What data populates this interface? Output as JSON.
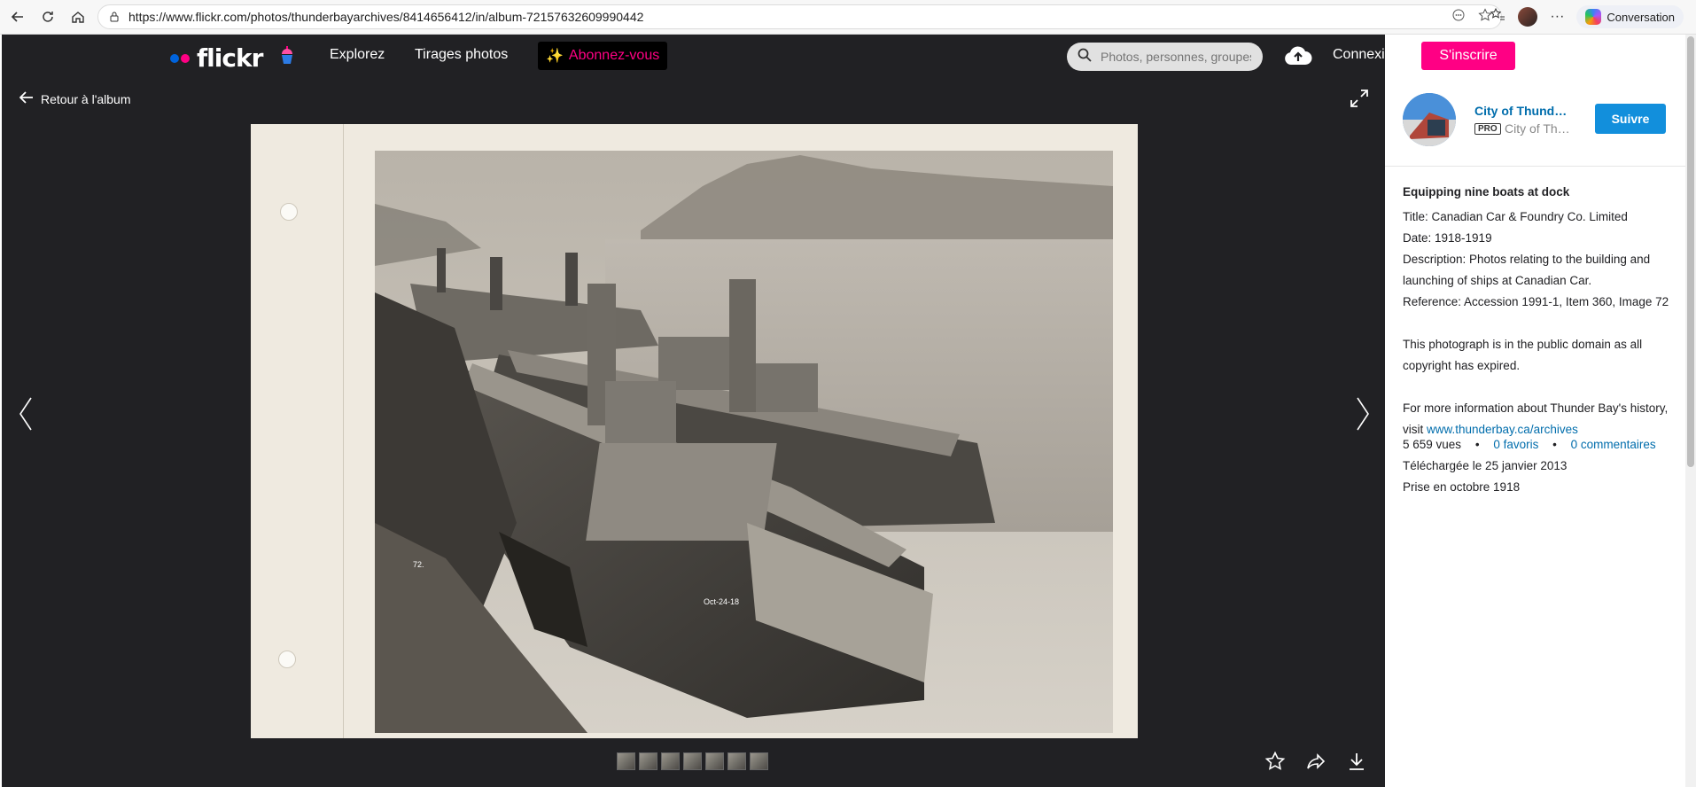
{
  "browser": {
    "url": "https://www.flickr.com/photos/thunderbayarchives/8414656412/in/album-72157632609990442",
    "conversation_label": "Conversation"
  },
  "header": {
    "logo": "flickr",
    "explore": "Explorez",
    "prints": "Tirages photos",
    "subscribe": "Abonnez-vous",
    "search_placeholder": "Photos, personnes, groupes",
    "login": "Connexion",
    "signup": "S'inscrire",
    "colors": {
      "blue_dot": "#0063dc",
      "pink_dot": "#ff0084",
      "bar": "#212124"
    }
  },
  "viewer": {
    "back_label": "Retour à l'album",
    "photo_caption_left": "72.",
    "photo_caption_right": "Oct-24-18",
    "thumbnail_count": 7
  },
  "owner": {
    "name": "City of Thunder Bay Archives",
    "pro_badge": "PRO",
    "subtitle": "City of Thunder Bay",
    "follow_label": "Suivre"
  },
  "details": {
    "title": "Equipping nine boats at dock",
    "lines": [
      "Title: Canadian Car & Foundry Co. Limited",
      "Date: 1918-1919",
      "Description: Photos relating to the building and launching of ships at Canadian Car.",
      "Reference: Accession 1991-1, Item 360, Image 72"
    ],
    "public_domain": "This photograph is in the public domain as all copyright has expired.",
    "more_info_prefix": "For more information about Thunder Bay's history, visit ",
    "more_info_link": "www.thunderbay.ca/archives"
  },
  "stats": {
    "views": "5 659 vues",
    "favorites": "0 favoris",
    "comments": "0 commentaires",
    "uploaded": "Téléchargée le 25 janvier 2013",
    "taken": "Prise en octobre 1918"
  }
}
